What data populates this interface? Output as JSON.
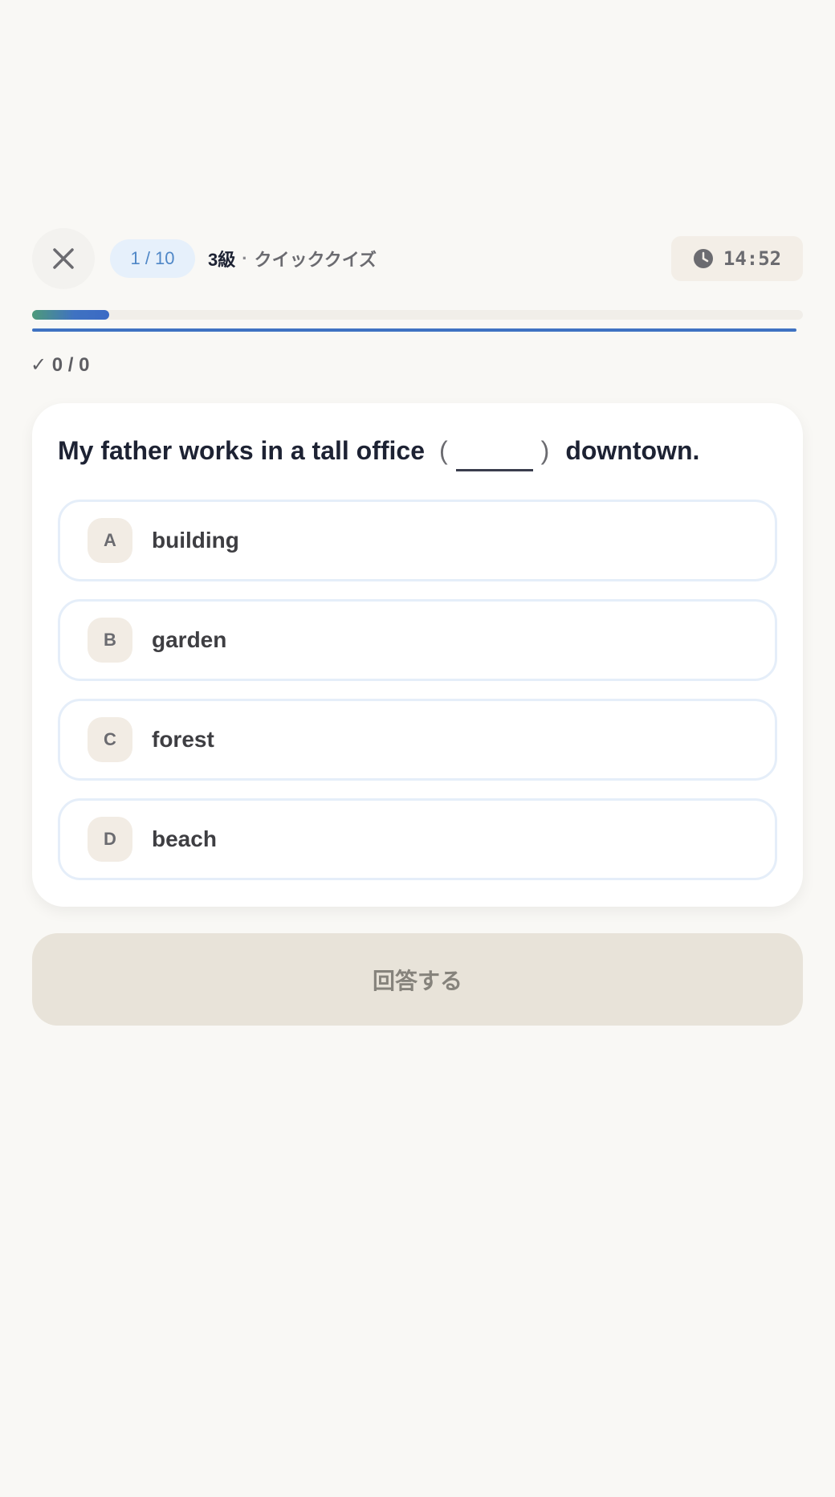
{
  "header": {
    "close_icon": "close-icon",
    "counter": "1 / 10",
    "level": "3級",
    "separator": "·",
    "quiz_name": "クイッククイズ",
    "timer_icon": "clock-icon",
    "timer": "14:52"
  },
  "progress": {
    "current": 1,
    "total": 10,
    "fraction": 0.1
  },
  "score": {
    "text": "✓ 0 / 0"
  },
  "question": {
    "before": "My father works in a tall office",
    "open_paren": "(",
    "close_paren": ")",
    "after": "downtown."
  },
  "options": [
    {
      "letter": "A",
      "text": "building"
    },
    {
      "letter": "B",
      "text": "garden"
    },
    {
      "letter": "C",
      "text": "forest"
    },
    {
      "letter": "D",
      "text": "beach"
    }
  ],
  "submit": {
    "label": "回答する"
  },
  "colors": {
    "background": "#f9f8f5",
    "accent_blue": "#3f72c2",
    "accent_green": "#4e9a7a",
    "text_dark": "#1d2233",
    "button_disabled": "#e8e3d9"
  }
}
